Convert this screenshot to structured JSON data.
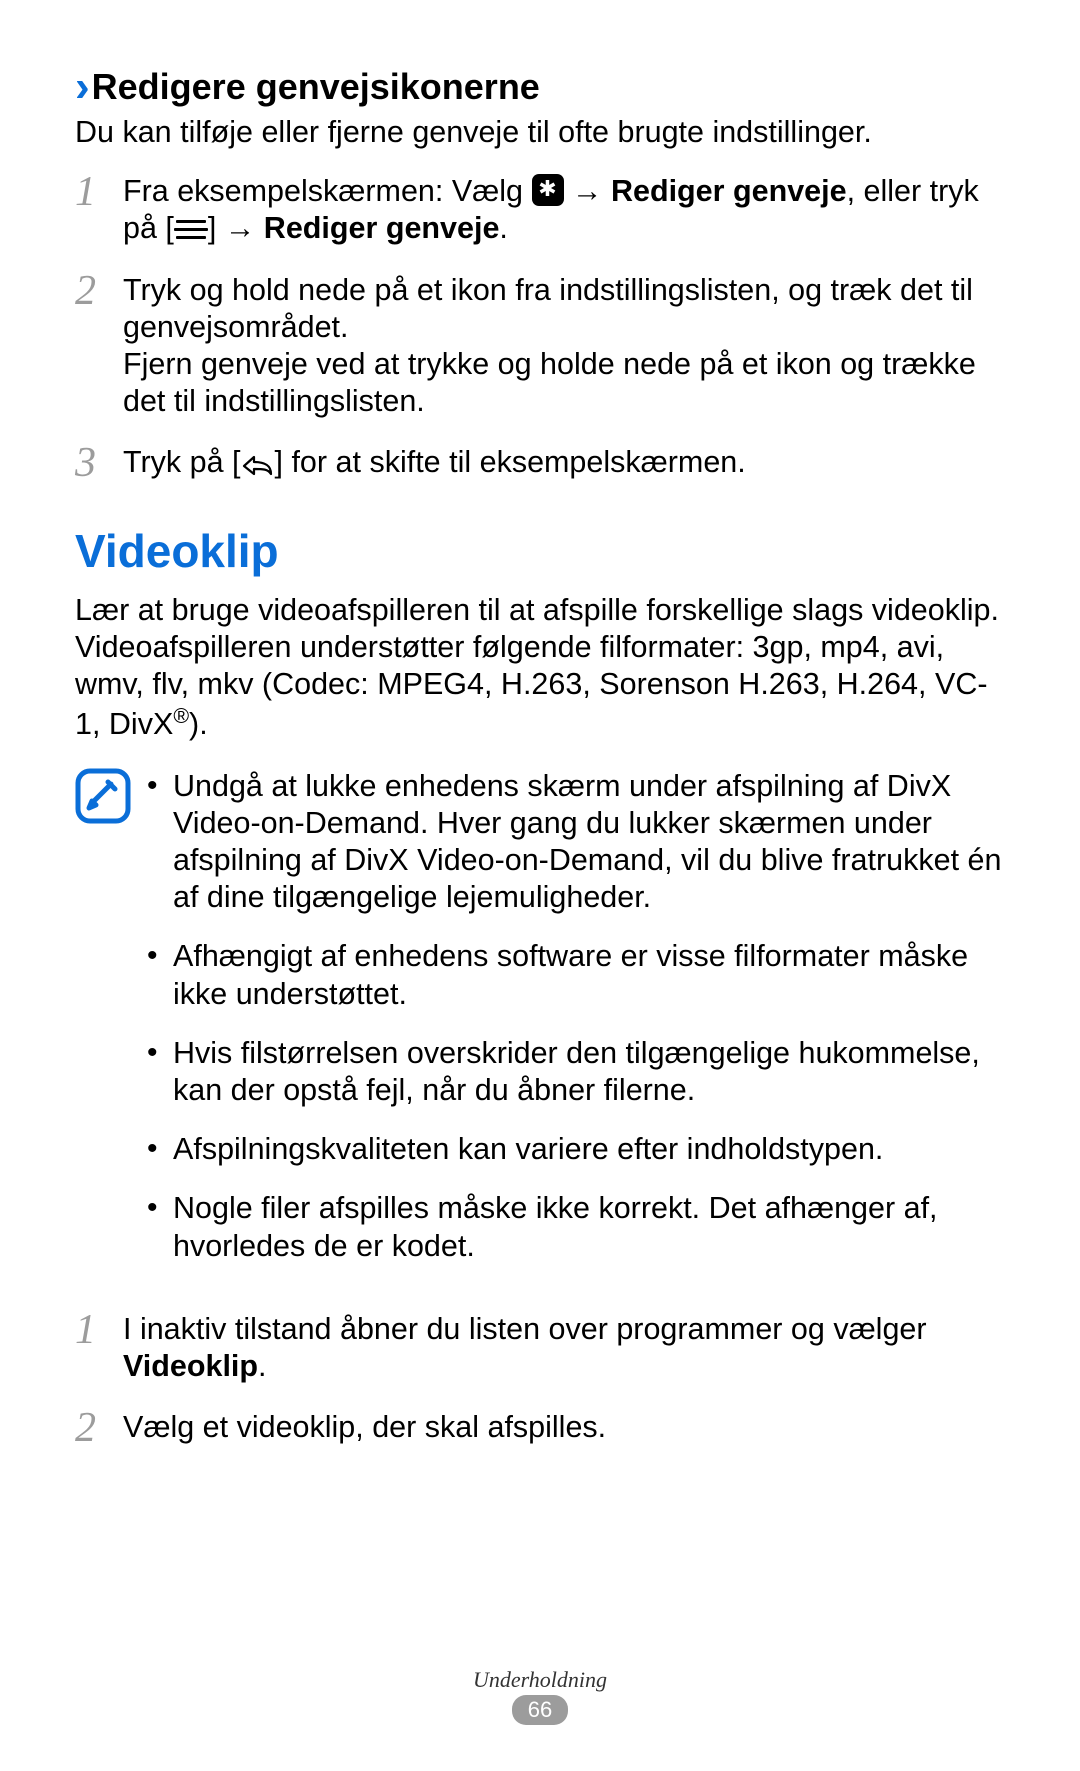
{
  "section1": {
    "title": "Redigere genvejsikonerne",
    "lead": "Du kan tilføje eller fjerne genveje til ofte brugte indstillinger.",
    "steps": {
      "s1": {
        "before_icon": "Fra eksempelskærmen: Vælg ",
        "after_icon": " → ",
        "bold1": "Rediger genveje",
        "after_bold1": ", eller tryk på [",
        "after_menu": "] → ",
        "bold2": "Rediger genveje",
        "after_bold2": "."
      },
      "s2": {
        "p1": "Tryk og hold nede på et ikon fra indstillingslisten, og træk det til genvejsområdet.",
        "p2": "Fjern genveje ved at trykke og holde nede på et ikon og trække det til indstillingslisten."
      },
      "s3": {
        "before": "Tryk på [",
        "after": "] for at skifte til eksempelskærmen."
      }
    }
  },
  "videoklip": {
    "title": "Videoklip",
    "intro_a": "Lær at bruge videoafspilleren til at afspille forskellige slags videoklip. Videoafspilleren understøtter følgende filformater: 3gp, mp4, avi, wmv, flv, mkv (Codec: MPEG4, H.263, Sorenson H.263, H.264, VC-1, DivX",
    "intro_sup": "®",
    "intro_b": ").",
    "notes": [
      "Undgå at lukke enhedens skærm under afspilning af DivX Video-on-Demand. Hver gang du lukker skærmen under afspilning af DivX Video-on-Demand, vil du blive fratrukket én af dine tilgængelige lejemuligheder.",
      "Afhængigt af enhedens software er visse filformater måske ikke understøttet.",
      "Hvis filstørrelsen overskrider den tilgængelige hukommelse, kan der opstå fejl, når du åbner filerne.",
      "Afspilningskvaliteten kan variere efter indholdstypen.",
      "Nogle filer afspilles måske ikke korrekt. Det afhænger af, hvorledes de er kodet."
    ],
    "steps": {
      "s1": {
        "before": "I inaktiv tilstand åbner du listen over programmer og vælger ",
        "bold": "Videoklip",
        "after": "."
      },
      "s2": "Vælg et videoklip, der skal afspilles."
    }
  },
  "footer": {
    "section": "Underholdning",
    "page": "66"
  }
}
